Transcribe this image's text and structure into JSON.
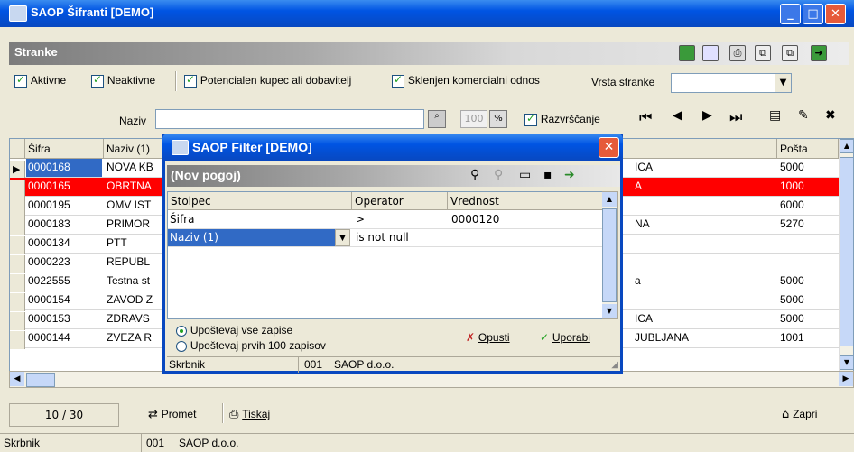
{
  "window": {
    "title": "SAOP Šifranti [DEMO]"
  },
  "toolbar": {
    "section_label": "Stranke"
  },
  "filters": {
    "aktivne": "Aktivne",
    "neaktivne": "Neaktivne",
    "potencialen": "Potencialen kupec ali dobavitelj",
    "sklenjen": "Sklenjen komercialni odnos",
    "vrsta_stranke_label": "Vrsta stranke",
    "vrsta_stranke_value": ""
  },
  "search": {
    "naziv_label": "Naziv",
    "naziv_value": "",
    "limit": "100",
    "razvrscanje": "Razvrščanje"
  },
  "grid": {
    "columns": {
      "sifra": "Šifra",
      "naziv": "Naziv (1)",
      "posta": "Pošta"
    },
    "rows": [
      {
        "sifra": "0000168",
        "naziv": "NOVA KB",
        "mesto": "ICA",
        "posta": "5000"
      },
      {
        "sifra": "0000165",
        "naziv": "OBRTNA",
        "mesto": "A",
        "posta": "1000"
      },
      {
        "sifra": "0000195",
        "naziv": "OMV IST",
        "mesto": "",
        "posta": "6000"
      },
      {
        "sifra": "0000183",
        "naziv": "PRIMOR",
        "mesto": "NA",
        "posta": "5270"
      },
      {
        "sifra": "0000134",
        "naziv": "PTT",
        "mesto": "",
        "posta": ""
      },
      {
        "sifra": "0000223",
        "naziv": "REPUBL",
        "mesto": "",
        "posta": ""
      },
      {
        "sifra": "0022555",
        "naziv": "Testna st",
        "mesto": "a",
        "posta": "5000"
      },
      {
        "sifra": "0000154",
        "naziv": "ZAVOD Z",
        "mesto": "",
        "posta": "5000"
      },
      {
        "sifra": "0000153",
        "naziv": "ZDRAVS",
        "mesto": "ICA",
        "posta": "5000"
      },
      {
        "sifra": "0000144",
        "naziv": "ZVEZA R",
        "mesto": "JUBLJANA",
        "posta": "1001"
      }
    ]
  },
  "status": {
    "record_counter": "10 / 30",
    "promet_label": "Promet",
    "tiskaj_label": "Tiskaj",
    "zapri_label": "Zapri",
    "skrbnik_label": "Skrbnik",
    "skrbnik_code": "001",
    "skrbnik_name": "SAOP d.o.o."
  },
  "dialog": {
    "title": "SAOP Filter [DEMO]",
    "section_label": "(Nov pogoj)",
    "columns": {
      "stolpec": "Stolpec",
      "operator": "Operator",
      "vrednost": "Vrednost"
    },
    "rows": [
      {
        "stolpec": "Šifra",
        "operator": ">",
        "vrednost": "0000120"
      },
      {
        "stolpec": "Naziv (1)",
        "operator": "is not null",
        "vrednost": ""
      }
    ],
    "radio_all": "Upoštevaj vse zapise",
    "radio_first": "Upoštevaj prvih 100 zapisov",
    "opusti_label": "Opusti",
    "uporabi_label": "Uporabi",
    "skrbnik_label": "Skrbnik",
    "skrbnik_code": "001",
    "skrbnik_name": "SAOP d.o.o."
  },
  "colors": {
    "titlebar": "#0054e3",
    "selected_row": "#ff0000",
    "cursor_row": "#316ac5",
    "accent_green": "#21a121"
  }
}
